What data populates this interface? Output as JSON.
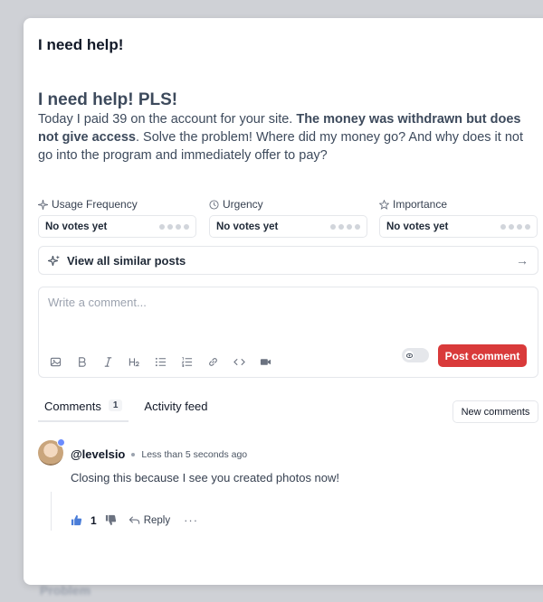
{
  "backdrop": {
    "text": "Problem"
  },
  "modal": {
    "title": "I need help!"
  },
  "post": {
    "title": "I need help! PLS!",
    "body_part1": "Today I paid 39 on the account for your site. ",
    "body_bold": "The money was withdrawn but does not give access",
    "body_part2": ". Solve the problem! Where did my money go? And why does it not go into the program and immediately offer to pay?"
  },
  "votes": [
    {
      "label": "Usage Frequency",
      "value": "No votes yet",
      "icon": "sparkle-icon"
    },
    {
      "label": "Urgency",
      "value": "No votes yet",
      "icon": "clock-icon"
    },
    {
      "label": "Importance",
      "value": "No votes yet",
      "icon": "star-icon"
    }
  ],
  "similar": {
    "label": "View all similar posts"
  },
  "comment_box": {
    "placeholder": "Write a comment...",
    "submit_label": "Post comment",
    "tools": [
      "image-icon",
      "bold-icon",
      "italic-icon",
      "heading-icon",
      "bullet-list-icon",
      "numbered-list-icon",
      "link-icon",
      "code-icon",
      "video-icon"
    ]
  },
  "tabs": {
    "comments_label": "Comments",
    "comments_count": "1",
    "activity_label": "Activity feed",
    "new_comments_label": "New comments"
  },
  "comment": {
    "author": "@levelsio",
    "time": "Less than 5 seconds ago",
    "text": "Closing this because I see you created photos now!",
    "likes": "1",
    "reply_label": "Reply",
    "more": "···"
  },
  "colors": {
    "accent_red": "#d93a3a",
    "like_blue": "#4a7dd8"
  }
}
